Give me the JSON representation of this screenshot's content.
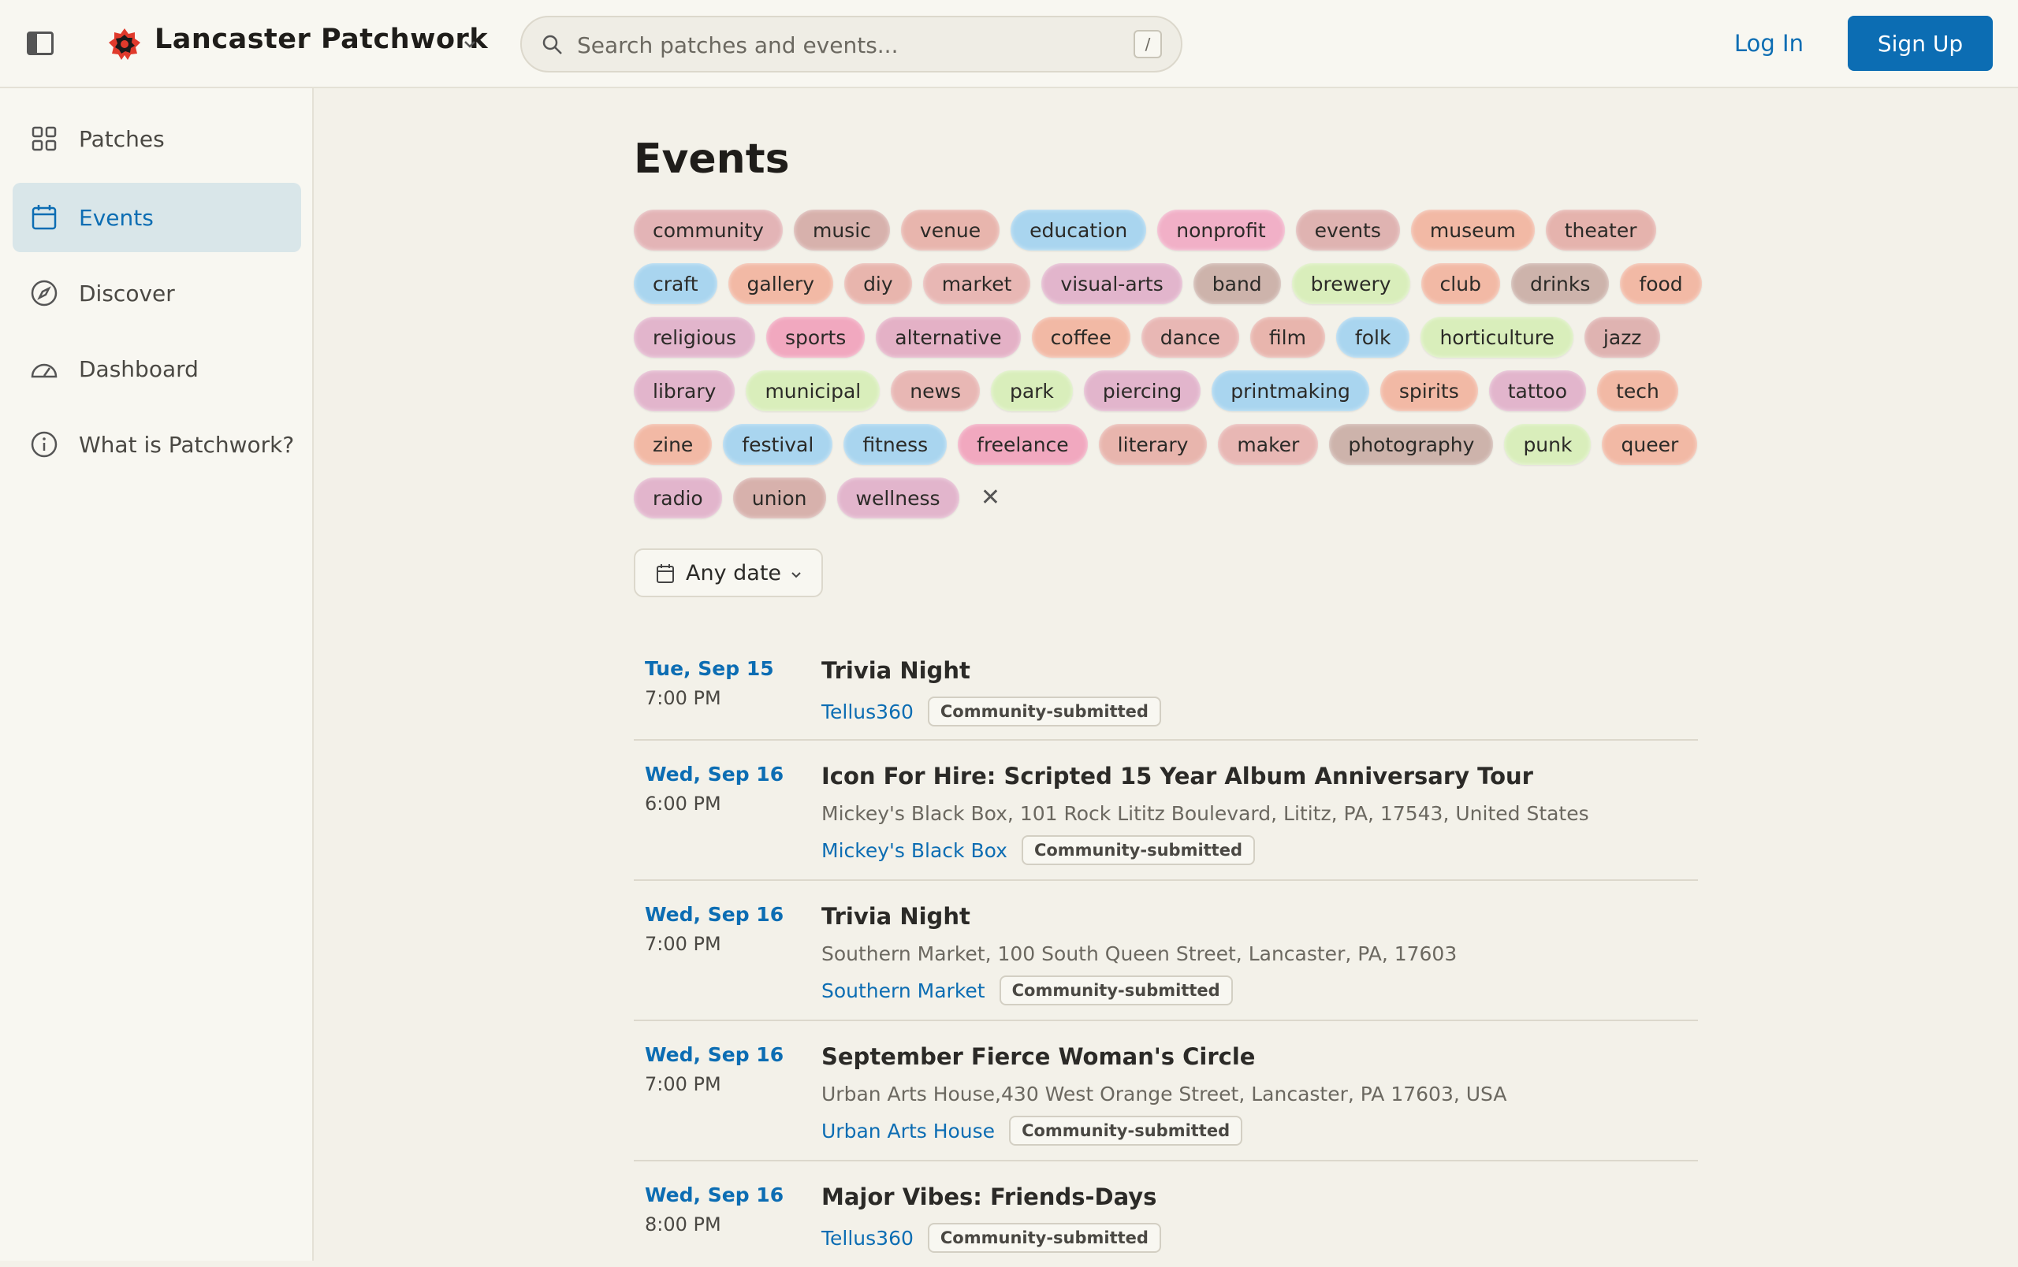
{
  "header": {
    "brand_name": "Lancaster Patchwork",
    "search_placeholder": "Search patches and events...",
    "search_shortcut": "/",
    "login_label": "Log In",
    "signup_label": "Sign Up",
    "accent_color": "#0c6db3"
  },
  "sidebar": {
    "items": [
      {
        "label": "Patches",
        "icon": "grid-icon",
        "active": false
      },
      {
        "label": "Events",
        "icon": "calendar-icon",
        "active": true
      },
      {
        "label": "Discover",
        "icon": "compass-icon",
        "active": false
      },
      {
        "label": "Dashboard",
        "icon": "gauge-icon",
        "active": false
      },
      {
        "label": "What is Patchwork?",
        "icon": "info-icon",
        "active": false
      }
    ]
  },
  "main": {
    "title": "Events",
    "tags": [
      {
        "label": "community",
        "color": "#e3b4b6"
      },
      {
        "label": "music",
        "color": "#d7b1ac"
      },
      {
        "label": "venue",
        "color": "#e8b5ad"
      },
      {
        "label": "education",
        "color": "#a9d5ef"
      },
      {
        "label": "nonprofit",
        "color": "#f1b0c7"
      },
      {
        "label": "events",
        "color": "#dfb3b1"
      },
      {
        "label": "museum",
        "color": "#f2b9a5"
      },
      {
        "label": "theater",
        "color": "#e5b3ad"
      },
      {
        "label": "craft",
        "color": "#a9d5ef"
      },
      {
        "label": "gallery",
        "color": "#f2b9a5"
      },
      {
        "label": "diy",
        "color": "#e8b5ad"
      },
      {
        "label": "market",
        "color": "#e8b7b4"
      },
      {
        "label": "visual-arts",
        "color": "#e2b5cc"
      },
      {
        "label": "band",
        "color": "#cdb3ab"
      },
      {
        "label": "brewery",
        "color": "#d9eebb"
      },
      {
        "label": "club",
        "color": "#f2b9a5"
      },
      {
        "label": "drinks",
        "color": "#cdb3ab"
      },
      {
        "label": "food",
        "color": "#f2b9a5"
      },
      {
        "label": "religious",
        "color": "#e2b5cc"
      },
      {
        "label": "sports",
        "color": "#f1a8bf"
      },
      {
        "label": "alternative",
        "color": "#e4b1c6"
      },
      {
        "label": "coffee",
        "color": "#f2b9a5"
      },
      {
        "label": "dance",
        "color": "#e8b7b4"
      },
      {
        "label": "film",
        "color": "#e8b5ad"
      },
      {
        "label": "folk",
        "color": "#a9d5ef"
      },
      {
        "label": "horticulture",
        "color": "#d9eebb"
      },
      {
        "label": "jazz",
        "color": "#dfb3b1"
      },
      {
        "label": "library",
        "color": "#e2b5cc"
      },
      {
        "label": "municipal",
        "color": "#d9eebb"
      },
      {
        "label": "news",
        "color": "#e8b7b4"
      },
      {
        "label": "park",
        "color": "#d9eebb"
      },
      {
        "label": "piercing",
        "color": "#e2b5cc"
      },
      {
        "label": "printmaking",
        "color": "#a9d5ef"
      },
      {
        "label": "spirits",
        "color": "#f2b9a5"
      },
      {
        "label": "tattoo",
        "color": "#e2b5cc"
      },
      {
        "label": "tech",
        "color": "#f2b9a5"
      },
      {
        "label": "zine",
        "color": "#f2b9a5"
      },
      {
        "label": "festival",
        "color": "#a9d5ef"
      },
      {
        "label": "fitness",
        "color": "#a9d5ef"
      },
      {
        "label": "freelance",
        "color": "#f1a8bf"
      },
      {
        "label": "literary",
        "color": "#e8b5ad"
      },
      {
        "label": "maker",
        "color": "#e8b7b4"
      },
      {
        "label": "photography",
        "color": "#cdb3ab"
      },
      {
        "label": "punk",
        "color": "#d9eebb"
      },
      {
        "label": "queer",
        "color": "#f2b9a5"
      },
      {
        "label": "radio",
        "color": "#e2b5cc"
      },
      {
        "label": "union",
        "color": "#d7b1ac"
      },
      {
        "label": "wellness",
        "color": "#e2b5cc"
      }
    ],
    "clear_tags_icon": "close-icon",
    "date_filter_label": "Any date",
    "events": [
      {
        "date": "Tue, Sep 15",
        "time": "7:00 PM",
        "title": "Trivia Night",
        "address": "",
        "venue": "Tellus360",
        "badge": "Community-submitted"
      },
      {
        "date": "Wed, Sep 16",
        "time": "6:00 PM",
        "title": "Icon For Hire: Scripted 15 Year Album Anniversary Tour",
        "address": "Mickey's Black Box, 101 Rock Lititz Boulevard, Lititz, PA, 17543, United States",
        "venue": "Mickey's Black Box",
        "badge": "Community-submitted"
      },
      {
        "date": "Wed, Sep 16",
        "time": "7:00 PM",
        "title": "Trivia Night",
        "address": "Southern Market, 100 South Queen Street, Lancaster, PA, 17603",
        "venue": "Southern Market",
        "badge": "Community-submitted"
      },
      {
        "date": "Wed, Sep 16",
        "time": "7:00 PM",
        "title": "September Fierce Woman's Circle",
        "address": "Urban Arts House,430 West Orange Street, Lancaster, PA 17603, USA",
        "venue": "Urban Arts House",
        "badge": "Community-submitted"
      },
      {
        "date": "Wed, Sep 16",
        "time": "8:00 PM",
        "title": "Major Vibes: Friends-Days",
        "address": "",
        "venue": "Tellus360",
        "badge": "Community-submitted"
      }
    ]
  }
}
